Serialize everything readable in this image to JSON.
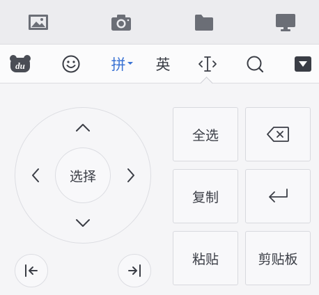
{
  "top_bar": {
    "icons": [
      "image-icon",
      "camera-icon",
      "folder-icon",
      "monitor-icon"
    ]
  },
  "toolbar": {
    "du_label": "du",
    "pinyin_label": "拼",
    "english_label": "英"
  },
  "edit_panel": {
    "center_label": "选择",
    "select_all_label": "全选",
    "copy_label": "复制",
    "paste_label": "粘贴",
    "clipboard_label": "剪贴板"
  },
  "colors": {
    "accent": "#3b73d4",
    "icon_gray": "#6b6e76",
    "text": "#3a3d45"
  }
}
